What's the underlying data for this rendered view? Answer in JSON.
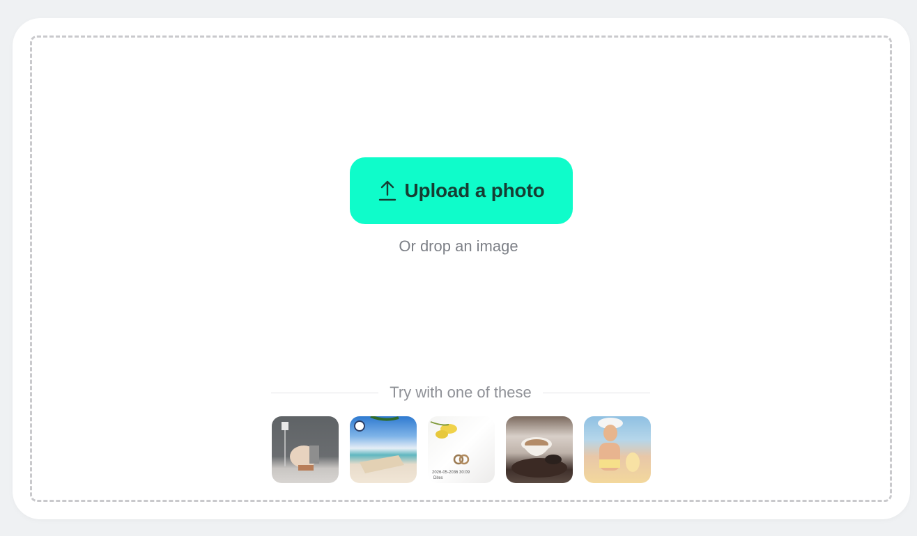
{
  "upload": {
    "button_label": "Upload a photo",
    "icon": "upload-icon",
    "hint": "Or drop an image"
  },
  "samples": {
    "heading": "Try with one of these",
    "items": [
      {
        "name": "sample-chair-room",
        "description": "Wicker chair with floor lamp against grey wall"
      },
      {
        "name": "sample-beach-bench",
        "description": "Beach lounge bench by the sea"
      },
      {
        "name": "sample-rings-flowers",
        "description": "Wedding rings with yellow flowers"
      },
      {
        "name": "sample-coffee-cup",
        "description": "Cup of coffee with coffee beans"
      },
      {
        "name": "sample-woman-beach",
        "description": "Woman with sun hat at the beach"
      }
    ]
  },
  "colors": {
    "accent": "#0ffcca",
    "button_text": "#163d33",
    "hint_text": "#7c7f86",
    "border_dashed": "#c9c9cc",
    "page_background": "#eff1f3"
  }
}
